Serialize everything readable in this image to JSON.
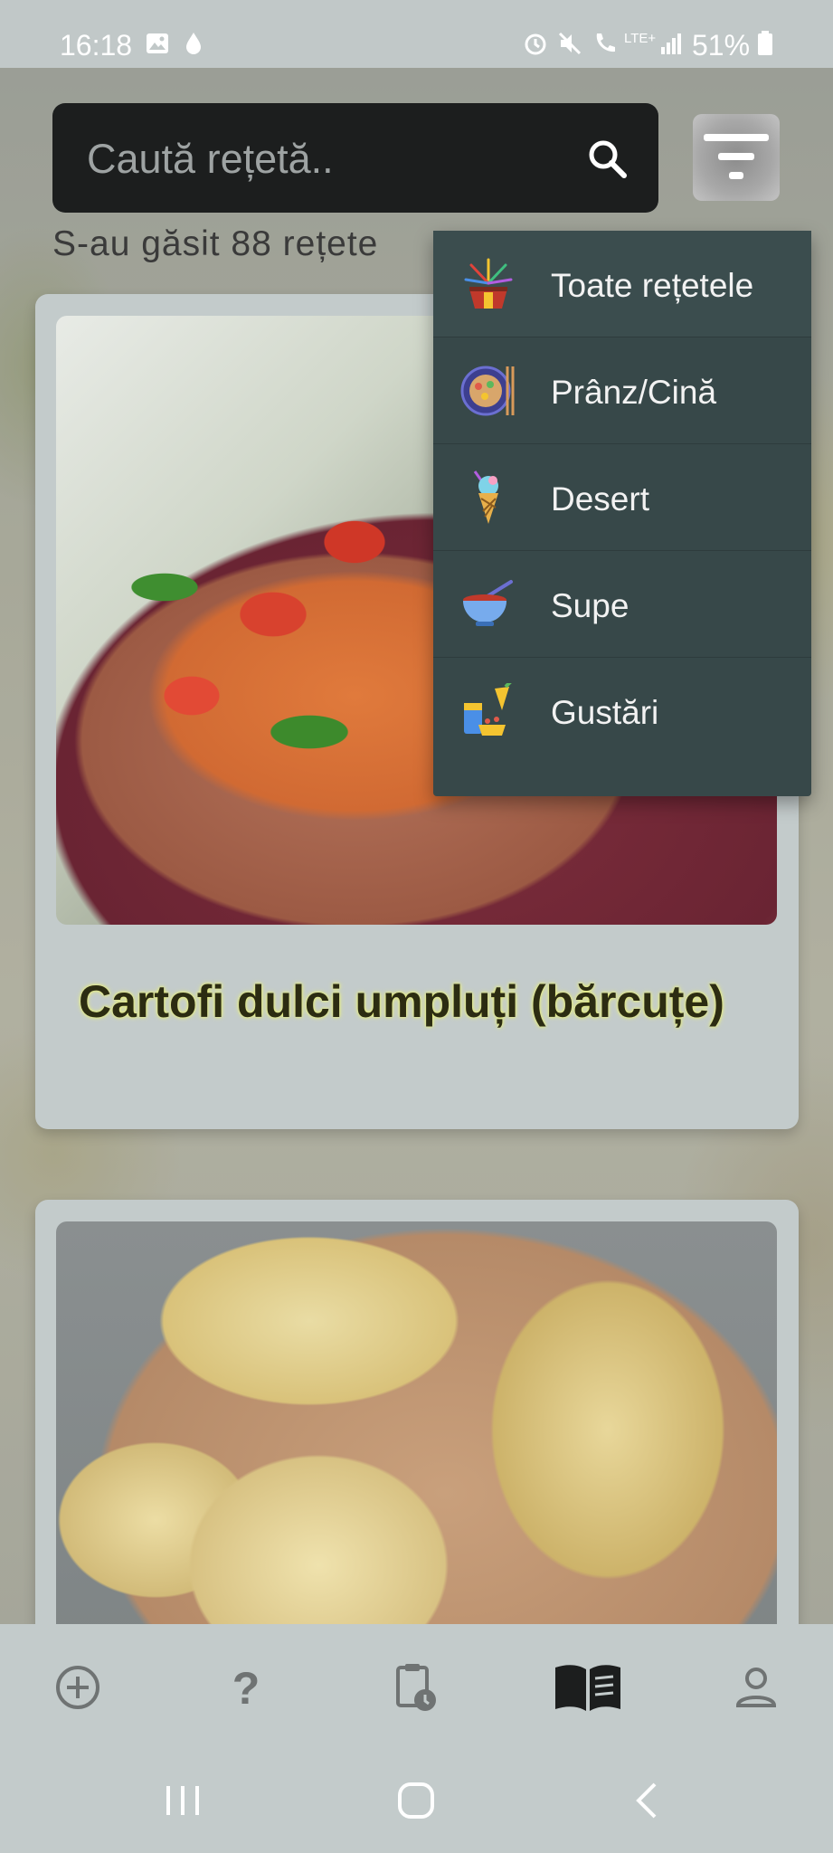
{
  "status_bar": {
    "time": "16:18",
    "battery": "51%",
    "network": "LTE+"
  },
  "search": {
    "placeholder": "Caută rețetă.."
  },
  "results": {
    "count_text": "S-au găsit 88 rețete"
  },
  "filter_menu": {
    "items": [
      {
        "label": "Toate rețetele",
        "icon": "fireworks-icon",
        "selected": true
      },
      {
        "label": "Prânz/Cină",
        "icon": "noodle-bowl-icon",
        "selected": false
      },
      {
        "label": "Desert",
        "icon": "ice-cream-icon",
        "selected": false
      },
      {
        "label": "Supe",
        "icon": "soup-bowl-icon",
        "selected": false
      },
      {
        "label": "Gustări",
        "icon": "snacks-icon",
        "selected": false
      }
    ]
  },
  "recipes": [
    {
      "title": "Cartofi dulci umpluți (bărcuțe)"
    },
    {
      "title": ""
    }
  ],
  "bottom_nav": [
    {
      "icon": "add-circle-icon"
    },
    {
      "icon": "help-icon"
    },
    {
      "icon": "clipboard-clock-icon"
    },
    {
      "icon": "book-icon",
      "active": true
    },
    {
      "icon": "person-icon"
    }
  ],
  "colors": {
    "menu_bg": "#374849",
    "search_bg": "#1c1e1e",
    "title_glow": "#e9f07a"
  }
}
